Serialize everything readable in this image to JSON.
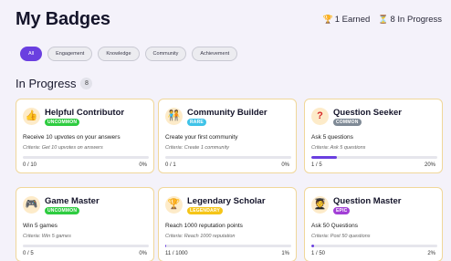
{
  "header": {
    "title": "My Badges",
    "earned_icon": "trophy-icon",
    "earned": "1 Earned",
    "progress_icon": "hourglass-icon",
    "in_progress": "8 In Progress"
  },
  "filters": {
    "selected": "All",
    "items": [
      "All",
      "Engagement",
      "Knowledge",
      "Community",
      "Achievement"
    ]
  },
  "section": {
    "title": "In Progress",
    "count": "8"
  },
  "colors": {
    "accent": "#6a3fe0",
    "card_border": "#f0d79a",
    "icon_bg": "#fdebc9"
  },
  "badges": [
    {
      "name": "Helpful Contributor",
      "icon": "thumbs-up-icon",
      "rarity": "UNCOMMON",
      "rarity_bg": "#2ecc40",
      "rarity_fg": "#ffffff",
      "description": "Receive 10 upvotes on your answers",
      "criteria": "Criteria: Get 10 upvotes on answers",
      "progress_text": "0 / 10",
      "percent_text": "0%",
      "progress": 0
    },
    {
      "name": "Community Builder",
      "icon": "people-icon",
      "rarity": "RARE",
      "rarity_bg": "#3fc3e8",
      "rarity_fg": "#ffffff",
      "description": "Create your first community",
      "criteria": "Criteria: Create 1 community",
      "progress_text": "0 / 1",
      "percent_text": "0%",
      "progress": 0
    },
    {
      "name": "Question Seeker",
      "icon": "question-mark-icon",
      "rarity": "COMMON",
      "rarity_bg": "#7f8a96",
      "rarity_fg": "#ffffff",
      "description": "Ask 5 questions",
      "criteria": "Criteria: Ask 5 questions",
      "progress_text": "1 / 5",
      "percent_text": "20%",
      "progress": 20
    },
    {
      "name": "Game Master",
      "icon": "game-controller-icon",
      "rarity": "UNCOMMON",
      "rarity_bg": "#2ecc40",
      "rarity_fg": "#ffffff",
      "description": "Win 5 games",
      "criteria": "Criteria: Win 5 games",
      "progress_text": "0 / 5",
      "percent_text": "0%",
      "progress": 0
    },
    {
      "name": "Legendary Scholar",
      "icon": "trophy-icon",
      "rarity": "LEGENDARY",
      "rarity_bg": "#f5c518",
      "rarity_fg": "#ffffff",
      "description": "Reach 1000 reputation points",
      "criteria": "Criteria: Reach 1000 reputation",
      "progress_text": "11 / 1000",
      "percent_text": "1%",
      "progress": 1
    },
    {
      "name": "Question Master",
      "icon": "scholar-icon",
      "rarity": "EPIC",
      "rarity_bg": "#a23fd6",
      "rarity_fg": "#ffffff",
      "description": "Ask 50 Questions",
      "criteria": "Criteria: Post 50 questions",
      "progress_text": "1 / 50",
      "percent_text": "2%",
      "progress": 2
    }
  ]
}
